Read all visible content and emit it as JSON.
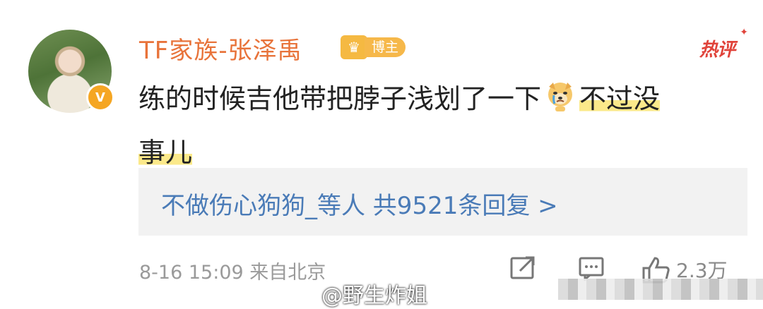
{
  "post": {
    "username": "TF家族-张泽禹",
    "badge_label": "博主",
    "hot_tag": "热评",
    "comment_part1": "练的时候吉他带把脖子浅划了一下",
    "comment_part2": "不过没",
    "comment_part3": "事儿",
    "emoji": "crying-dog-emoji",
    "replies_text": "不做伤心狗狗_等人  共9521条回复 >",
    "timestamp": "8-16 15:09  来自北京",
    "like_count": "2.3万",
    "watermark": "@野生炸姐",
    "highlight_color": "#fbe98a",
    "username_color": "#e8733a",
    "link_color": "#4a7bb7"
  }
}
